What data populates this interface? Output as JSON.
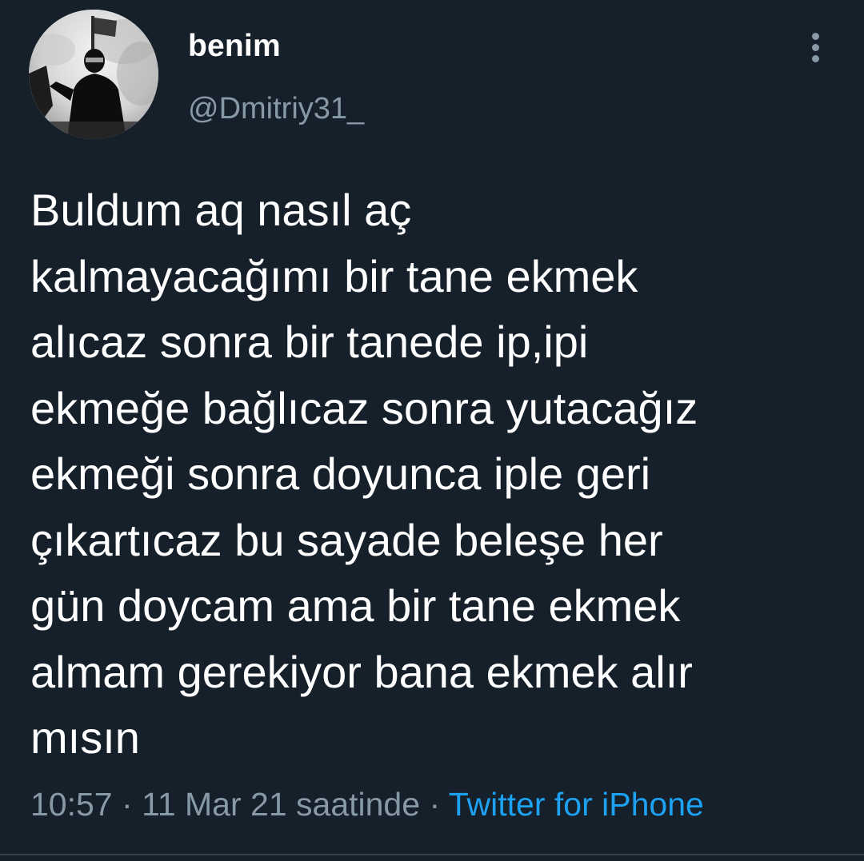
{
  "user": {
    "display_name": "benim",
    "handle": "@Dmitriy31_",
    "avatar_icon": "profile-photo"
  },
  "menu": {
    "icon": "more-vertical-icon"
  },
  "tweet": {
    "text_lines": [
      "Buldum aq nasıl aç",
      "kalmayacağımı bir tane ekmek",
      "alıcaz sonra bir tanede ip,ipi",
      "ekmeğe bağlıcaz sonra yutacağız",
      "ekmeği sonra doyunca iple geri",
      "çıkartıcaz bu sayade beleşe her",
      "gün doycam ama bir tane  ekmek",
      "almam gerekiyor bana ekmek alır",
      "mısın"
    ],
    "time": "10:57",
    "separator": "·",
    "date": "11 Mar 21 saatinde",
    "source": "Twitter for iPhone"
  },
  "colors": {
    "background": "#15202b",
    "secondary_text": "#8899a6",
    "link": "#1da1f2"
  }
}
